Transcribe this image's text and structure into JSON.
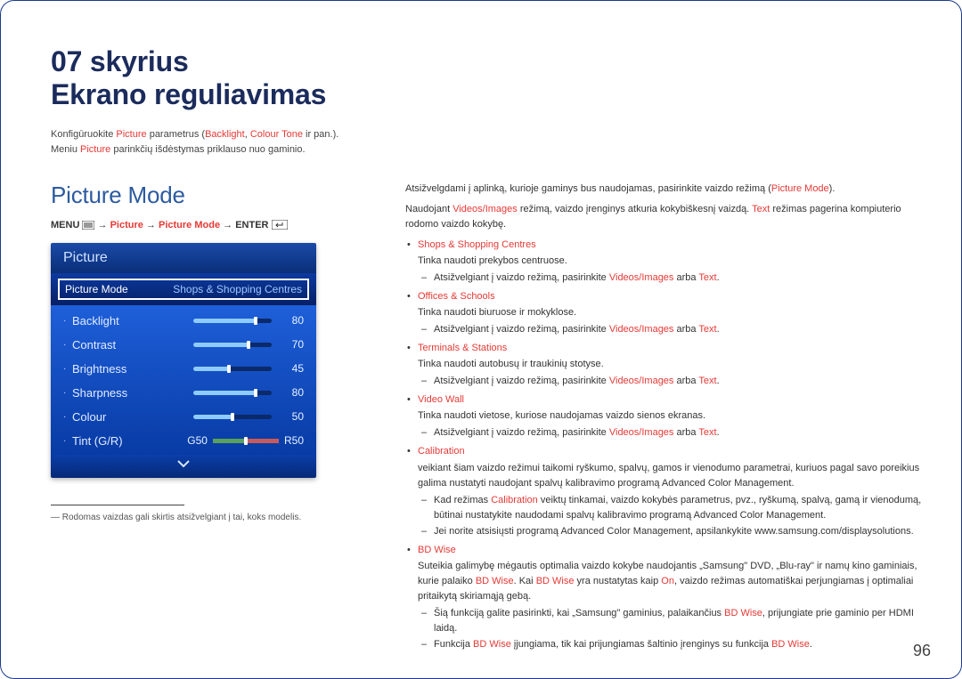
{
  "chapter": {
    "num": "07 skyrius",
    "title": "Ekrano reguliavimas"
  },
  "intro": {
    "l1a": "Konfigūruokite ",
    "l1_picture": "Picture",
    "l1b": " parametrus (",
    "l1_backlight": "Backlight",
    "l1c": ", ",
    "l1_colour_tone": "Colour Tone",
    "l1d": " ir pan.).",
    "l2a": "Meniu ",
    "l2_picture": "Picture",
    "l2b": " parinkčių išdėstymas priklauso nuo gaminio."
  },
  "section_title": "Picture Mode",
  "breadcrumb": {
    "menu": "MENU",
    "picture": "Picture",
    "picture_mode": "Picture Mode",
    "enter": "ENTER"
  },
  "osd": {
    "header": "Picture",
    "selected": {
      "label": "Picture Mode",
      "value": "Shops & Shopping Centres"
    },
    "rows": [
      {
        "label": "Backlight",
        "value": 80,
        "max": 100
      },
      {
        "label": "Contrast",
        "value": 70,
        "max": 100
      },
      {
        "label": "Brightness",
        "value": 45,
        "max": 100
      },
      {
        "label": "Sharpness",
        "value": 80,
        "max": 100
      },
      {
        "label": "Colour",
        "value": 50,
        "max": 100
      }
    ],
    "tint": {
      "label": "Tint (G/R)",
      "g": "G50",
      "r": "R50"
    }
  },
  "footnote": "― Rodomas vaizdas gali skirtis atsižvelgiant į tai, koks modelis.",
  "right": {
    "p1a": "Atsižvelgdami į aplinką, kurioje gaminys bus naudojamas, pasirinkite vaizdo režimą (",
    "p1_pm": "Picture Mode",
    "p1b": ").",
    "p2a": "Naudojant ",
    "p2_vi": "Videos/Images",
    "p2b": " režimą, vaizdo įrenginys atkuria kokybiškesnį vaizdą. ",
    "p2_text": "Text",
    "p2c": " režimas pagerina kompiuterio rodomo vaizdo kokybę.",
    "modes": [
      {
        "name": "Shops & Shopping Centres",
        "desc": "Tinka naudoti prekybos centruose.",
        "sub": [
          {
            "a": "Atsižvelgiant į vaizdo režimą, pasirinkite ",
            "link1": "Videos/Images",
            "mid": " arba ",
            "link2": "Text",
            "end": "."
          }
        ]
      },
      {
        "name": "Offices & Schools",
        "desc": "Tinka naudoti biuruose ir mokyklose.",
        "sub": [
          {
            "a": "Atsižvelgiant į vaizdo režimą, pasirinkite ",
            "link1": "Videos/Images",
            "mid": " arba ",
            "link2": "Text",
            "end": "."
          }
        ]
      },
      {
        "name": "Terminals & Stations",
        "desc": "Tinka naudoti autobusų ir traukinių stotyse.",
        "sub": [
          {
            "a": "Atsižvelgiant į vaizdo režimą, pasirinkite ",
            "link1": "Videos/Images",
            "mid": " arba ",
            "link2": "Text",
            "end": "."
          }
        ]
      },
      {
        "name": "Video Wall",
        "desc": "Tinka naudoti vietose, kuriose naudojamas vaizdo sienos ekranas.",
        "sub": [
          {
            "a": "Atsižvelgiant į vaizdo režimą, pasirinkite ",
            "link1": "Videos/Images",
            "mid": " arba ",
            "link2": "Text",
            "end": "."
          }
        ]
      },
      {
        "name": "Calibration",
        "desc": "veikiant šiam vaizdo režimui taikomi ryškumo, spalvų, gamos ir vienodumo parametrai, kuriuos pagal savo poreikius galima nustatyti naudojant spalvų kalibravimo programą Advanced Color Management.",
        "sub": [
          {
            "a": "Kad režimas ",
            "link1": "Calibration",
            "mid": " veiktų tinkamai, vaizdo kokybės parametrus, pvz., ryškumą, spalvą, gamą ir vienodumą, būtinai nustatykite naudodami spalvų kalibravimo programą Advanced Color Management.",
            "link2": "",
            "end": ""
          },
          {
            "a": "Jei norite atsisiųsti programą Advanced Color Management, apsilankykite www.samsung.com/displaysolutions.",
            "link1": "",
            "mid": "",
            "link2": "",
            "end": ""
          }
        ]
      },
      {
        "name": "BD Wise",
        "desc_a": "Suteikia galimybę mėgautis optimalia vaizdo kokybe naudojantis „Samsung\" DVD, „Blu-ray\" ir namų kino gaminiais, kurie palaiko ",
        "desc_link1": "BD Wise",
        "desc_b": ". Kai ",
        "desc_link2": "BD Wise",
        "desc_c": " yra nustatytas kaip ",
        "desc_link3": "On",
        "desc_d": ", vaizdo režimas automatiškai perjungiamas į optimaliai pritaikytą skiriamąją gebą.",
        "sub": [
          {
            "a": "Šią funkciją galite pasirinkti, kai „Samsung\" gaminius, palaikančius ",
            "link1": "BD Wise",
            "mid": ", prijungiate prie gaminio per HDMI laidą.",
            "link2": "",
            "end": ""
          },
          {
            "a": "Funkcija ",
            "link1": "BD Wise",
            "mid": " įjungiama, tik kai prijungiamas šaltinio įrenginys su funkcija ",
            "link2": "BD Wise",
            "end": "."
          }
        ]
      }
    ]
  },
  "page_number": "96"
}
